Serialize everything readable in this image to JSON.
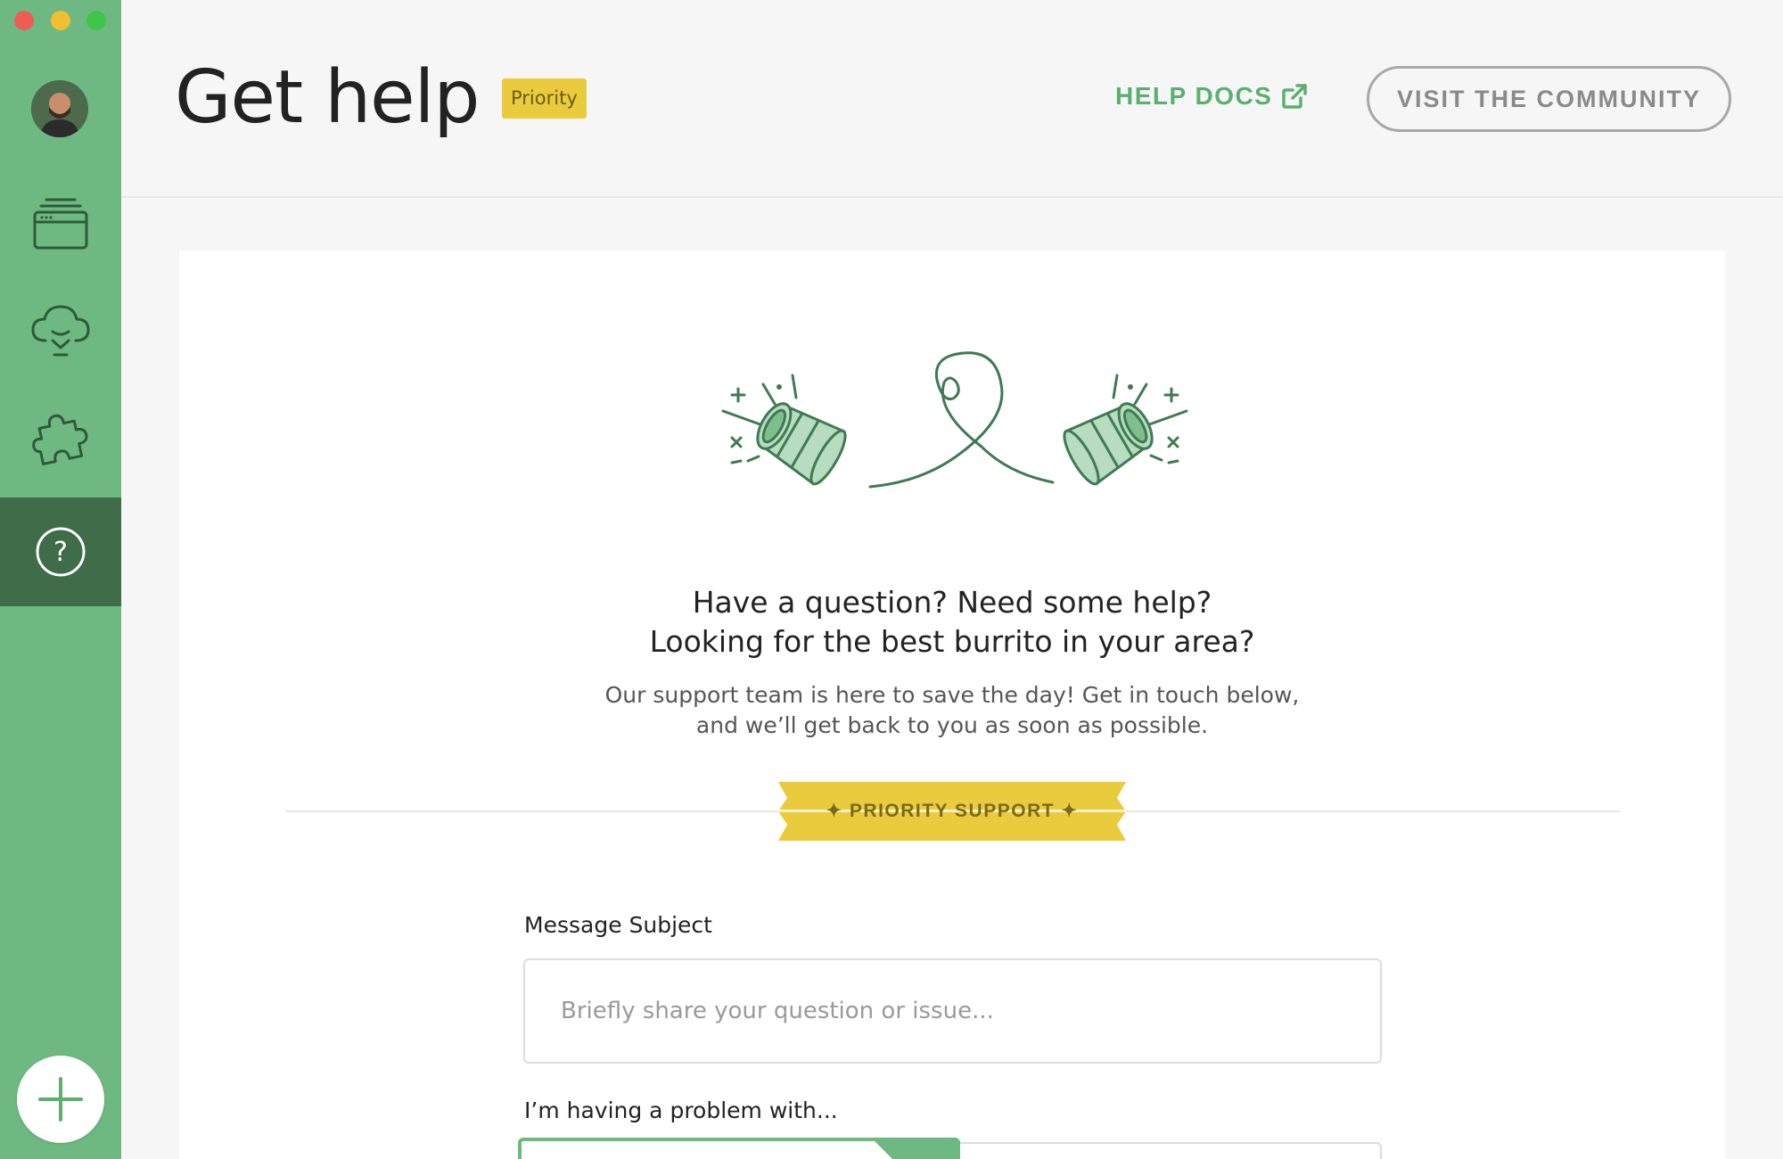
{
  "window": {
    "controls": [
      "close",
      "minimize",
      "maximize"
    ]
  },
  "sidebar": {
    "avatar_alt": "User avatar",
    "items": [
      {
        "name": "apps",
        "icon": "window-stack-icon"
      },
      {
        "name": "cloud",
        "icon": "cloud-download-icon"
      },
      {
        "name": "addons",
        "icon": "puzzle-icon"
      },
      {
        "name": "help",
        "icon": "question-circle-icon",
        "active": true
      }
    ],
    "add_icon": "plus-icon"
  },
  "header": {
    "title": "Get help",
    "badge": "Priority",
    "help_docs_label": "HELP DOCS",
    "community_label": "VISIT THE COMMUNITY"
  },
  "main": {
    "headline_line1": "Have a question? Need some help?",
    "headline_line2": "Looking for the best burrito in your area?",
    "subtext_line1": "Our support team is here to save the day! Get in touch below,",
    "subtext_line2": "and we’ll get back to you as soon as possible.",
    "ribbon_label": "✦ PRIORITY SUPPORT ✦",
    "form": {
      "subject_label": "Message Subject",
      "subject_placeholder": "Briefly share your question or issue...",
      "subject_value": "",
      "problem_label": "I’m having a problem with..."
    }
  },
  "colors": {
    "sidebar": "#6eb982",
    "sidebar_active": "#3f6c49",
    "accent": "#5bb06e",
    "badge": "#ebcb3e",
    "illustration": "#3f7a52",
    "illustration_fill": "#b7dcc0"
  }
}
